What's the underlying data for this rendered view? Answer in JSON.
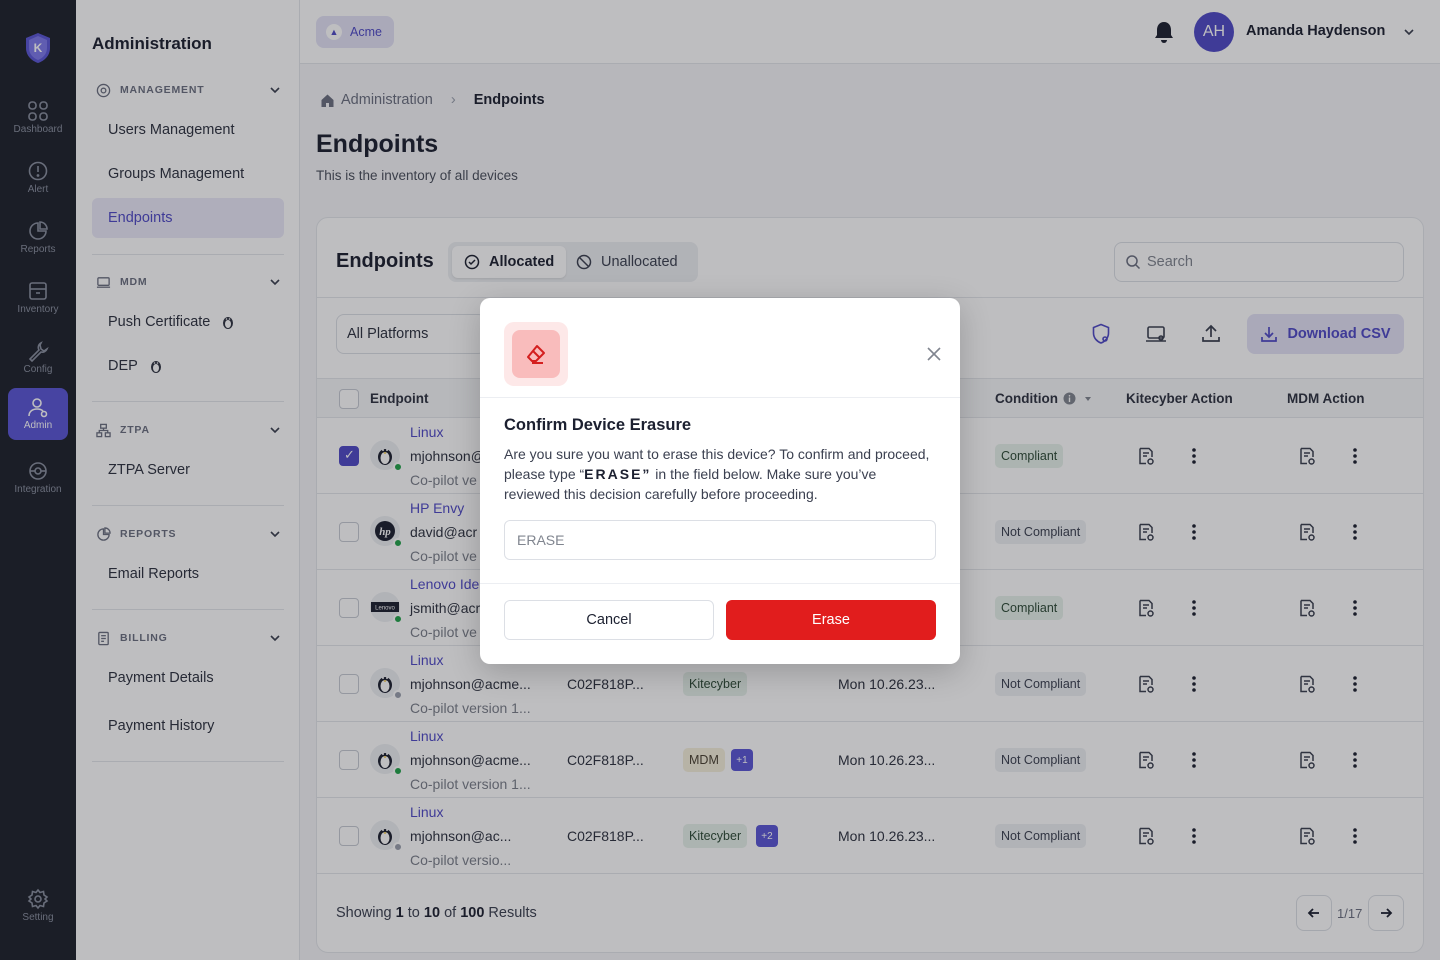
{
  "rail": {
    "items": [
      {
        "label": "Dashboard"
      },
      {
        "label": "Alert"
      },
      {
        "label": "Reports"
      },
      {
        "label": "Inventory"
      },
      {
        "label": "Config"
      },
      {
        "label": "Admin"
      },
      {
        "label": "Integration"
      },
      {
        "label": "Setting"
      }
    ]
  },
  "sidebar": {
    "title": "Administration",
    "sections": [
      {
        "title": "MANAGEMENT",
        "items": [
          "Users Management",
          "Groups Management",
          "Endpoints"
        ]
      },
      {
        "title": "MDM",
        "items": [
          "Push Certificate",
          "DEP"
        ]
      },
      {
        "title": "ZTPA",
        "items": [
          "ZTPA Server"
        ]
      },
      {
        "title": "REPORTS",
        "items": [
          "Email Reports"
        ]
      },
      {
        "title": "BILLING",
        "items": [
          "Payment Details",
          "Payment History"
        ]
      }
    ]
  },
  "topbar": {
    "org": "Acme",
    "user_initials": "AH",
    "user_name": "Amanda Haydenson"
  },
  "breadcrumb": {
    "root": "Administration",
    "current": "Endpoints"
  },
  "page": {
    "title": "Endpoints",
    "subtitle": "This is the inventory of all devices"
  },
  "card": {
    "title": "Endpoints",
    "tabs": [
      "Allocated",
      "Unallocated"
    ],
    "search_placeholder": "Search",
    "platform_filter": "All Platforms",
    "download_label": "Download CSV"
  },
  "table": {
    "columns": {
      "endpoint": "Endpoint",
      "condition": "Condition",
      "kitecyber_action": "Kitecyber Action",
      "mdm_action": "MDM Action"
    },
    "rows": [
      {
        "name": "Linux",
        "email": "mjohnson@",
        "version": "Co-pilot ve",
        "serial": "",
        "tag": "",
        "plus": "",
        "date": "",
        "condition": "Compliant",
        "logo": "linux",
        "status_color": "#22a34a",
        "checked": true
      },
      {
        "name": "HP Envy",
        "email": "david@acr",
        "version": "Co-pilot ve",
        "serial": "",
        "tag": "",
        "plus": "",
        "date": "",
        "condition": "Not Compliant",
        "logo": "hp",
        "status_color": "#22a34a",
        "checked": false
      },
      {
        "name": "Lenovo Ide",
        "email": "jsmith@acr",
        "version": "Co-pilot ve",
        "serial": "",
        "tag": "",
        "plus": "",
        "date": "",
        "condition": "Compliant",
        "logo": "lenovo",
        "status_color": "#22a34a",
        "checked": false
      },
      {
        "name": "Linux",
        "email": "mjohnson@acme...",
        "version": "Co-pilot version 1...",
        "serial": "C02F818P...",
        "tag": "Kitecyber",
        "plus": "",
        "date": "Mon 10.26.23...",
        "condition": "Not Compliant",
        "logo": "linux",
        "status_color": "#9aa0ad",
        "checked": false
      },
      {
        "name": "Linux",
        "email": "mjohnson@acme...",
        "version": "Co-pilot version 1...",
        "serial": "C02F818P...",
        "tag": "MDM",
        "plus": "+1",
        "date": "Mon 10.26.23...",
        "condition": "Not Compliant",
        "logo": "linux",
        "status_color": "#22a34a",
        "checked": false
      },
      {
        "name": "Linux",
        "email": "mjohnson@ac...",
        "version": "Co-pilot versio...",
        "serial": "C02F818P...",
        "tag": "Kitecyber",
        "plus": "+2",
        "date": "Mon 10.26.23...",
        "condition": "Not Compliant",
        "logo": "linux",
        "status_color": "#9aa0ad",
        "checked": false
      }
    ]
  },
  "footer": {
    "prefix": "Showing",
    "from": "1",
    "to_word": "to",
    "to": "10",
    "of_word": "of",
    "total": "100",
    "suffix": "Results",
    "page_indicator": "1/17"
  },
  "modal": {
    "title": "Confirm Device Erasure",
    "body_pre": "Are you sure you want to erase this device? To confirm and proceed, please type “",
    "body_keyword": "ERASE”",
    "body_post": " in the field below. Make sure you’ve reviewed this decision carefully before proceeding.",
    "input_placeholder": "ERASE",
    "cancel_label": "Cancel",
    "erase_label": "Erase"
  },
  "colors": {
    "accent": "#4f4ac6",
    "danger": "#e11d1d",
    "rail_bg": "#1e222b"
  }
}
